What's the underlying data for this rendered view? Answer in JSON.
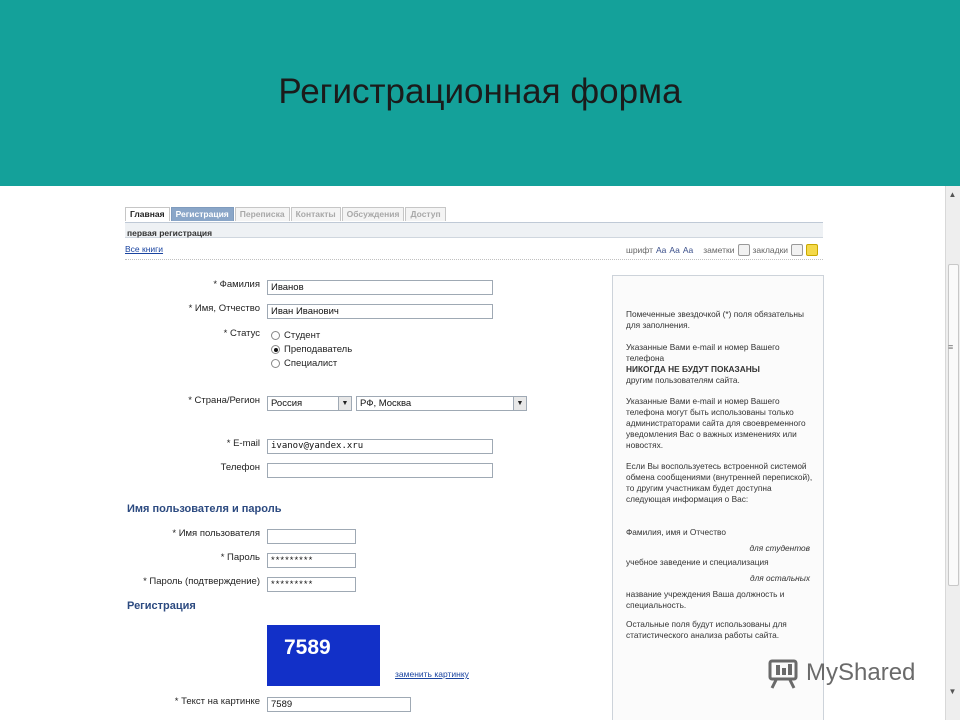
{
  "slide": {
    "title": "Регистрационная форма"
  },
  "tabs": [
    {
      "label": "Главная"
    },
    {
      "label": "Регистрация"
    },
    {
      "label": "Переписка"
    },
    {
      "label": "Контакты"
    },
    {
      "label": "Обсуждения"
    },
    {
      "label": "Доступ"
    }
  ],
  "subbar": {
    "text": "первая регистрация"
  },
  "links": {
    "books": "Все книги",
    "change_picture": "заменить картинку"
  },
  "tools": {
    "font": "шрифт",
    "aa": "Aa",
    "notes": "заметки",
    "bookmarks": "закладки"
  },
  "form": {
    "surname": {
      "label": "* Фамилия",
      "value": "Иванов"
    },
    "name": {
      "label": "* Имя, Отчество",
      "value": "Иван Иванович"
    },
    "status": {
      "label": "* Статус",
      "options": [
        {
          "label": "Студент",
          "selected": false
        },
        {
          "label": "Преподаватель",
          "selected": true
        },
        {
          "label": "Специалист",
          "selected": false
        }
      ]
    },
    "country": {
      "label": "* Страна/Регион",
      "country_value": "Россия",
      "region_value": "РФ, Москва"
    },
    "email": {
      "label": "* E-mail",
      "value": "ivanov@yandex.xru"
    },
    "phone": {
      "label": "Телефон",
      "value": ""
    },
    "section_account": "Имя пользователя и пароль",
    "username": {
      "label": "* Имя пользователя",
      "value": ""
    },
    "password": {
      "label": "* Пароль",
      "value": "*********"
    },
    "password_confirm": {
      "label": "* Пароль (подтверждение)",
      "value": "*********"
    },
    "section_registration": "Регистрация",
    "captcha": {
      "code": "7589"
    },
    "captcha_text": {
      "label": "* Текст на картинке",
      "value": "7589"
    }
  },
  "info": {
    "p1": "Помеченные звездочкой (*) поля обязательны для заполнения.",
    "p2a": "Указанные Вами e-mail и номер Вашего телефона",
    "p2b": "НИКОГДА НЕ БУДУТ ПОКАЗАНЫ",
    "p2c": "другим пользователям сайта.",
    "p3": "Указанные Вами e-mail и номер Вашего телефона могут быть использованы только администраторами сайта для своевременного уведомления Вас о важных изменениях или новостях.",
    "p4": "Если Вы воспользуетесь встроенной системой обмена сообщениями (внутренней перепиской), то другим участникам будет доступна следующая информация о Вас:",
    "p5": "Фамилия, имя и Отчество",
    "p6": "для студентов",
    "p7": "учебное заведение и специализация",
    "p8": "для остальных",
    "p9": "название учреждения Ваша должность и специальность.",
    "p10": "Остальные поля будут использованы для статистического анализа работы сайта."
  },
  "watermark": {
    "text": "MyShared"
  },
  "colors": {
    "header": "#14a19a",
    "active_tab": "#8aa6c8",
    "captcha_bg": "#1230c8",
    "link": "#1a44a0"
  }
}
